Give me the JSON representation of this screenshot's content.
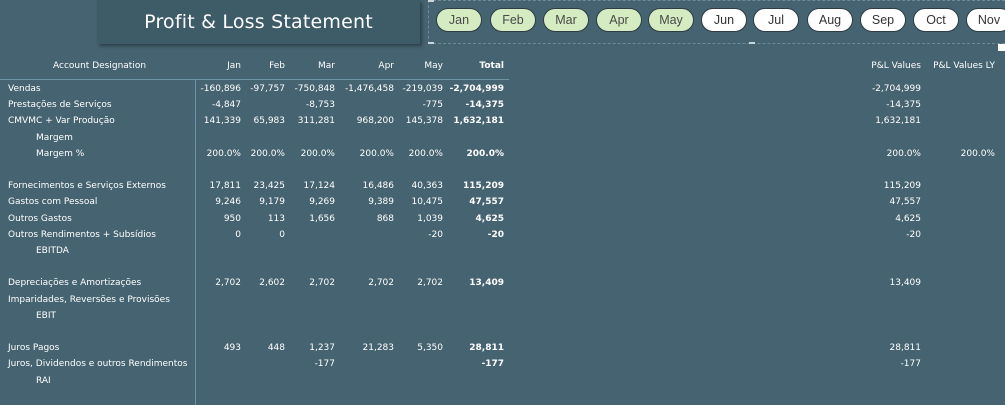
{
  "title": "Profit & Loss Statement",
  "months": [
    {
      "label": "Jan",
      "selected": true
    },
    {
      "label": "Feb",
      "selected": true
    },
    {
      "label": "Mar",
      "selected": true
    },
    {
      "label": "Apr",
      "selected": true
    },
    {
      "label": "May",
      "selected": true
    },
    {
      "label": "Jun",
      "selected": false
    },
    {
      "label": "Jul",
      "selected": false
    },
    {
      "label": "Aug",
      "selected": false
    },
    {
      "label": "Sep",
      "selected": false
    },
    {
      "label": "Oct",
      "selected": false
    },
    {
      "label": "Nov",
      "selected": false
    }
  ],
  "matrix": {
    "header": {
      "account": "Account Designation",
      "months": [
        "Jan",
        "Feb",
        "Mar",
        "Apr",
        "May"
      ],
      "total": "Total"
    },
    "rows": [
      {
        "label": "Vendas",
        "indent": false,
        "values": [
          "-160,896",
          "-97,757",
          "-750,848",
          "-1,476,458",
          "-219,039"
        ],
        "total": "-2,704,999"
      },
      {
        "label": "Prestações de Serviços",
        "indent": false,
        "values": [
          "-4,847",
          "",
          "-8,753",
          "",
          "-775"
        ],
        "total": "-14,375"
      },
      {
        "label": "CMVMC + Var Produção",
        "indent": false,
        "values": [
          "141,339",
          "65,983",
          "311,281",
          "968,200",
          "145,378"
        ],
        "total": "1,632,181"
      },
      {
        "label": "Margem",
        "indent": true,
        "values": [
          "",
          "",
          "",
          "",
          ""
        ],
        "total": ""
      },
      {
        "label": "Margem %",
        "indent": true,
        "values": [
          "200.0%",
          "200.0%",
          "200.0%",
          "200.0%",
          "200.0%"
        ],
        "total": "200.0%"
      },
      {
        "label": "",
        "indent": false,
        "values": [
          "",
          "",
          "",
          "",
          ""
        ],
        "total": ""
      },
      {
        "label": "Fornecimentos e Serviços Externos",
        "indent": false,
        "values": [
          "17,811",
          "23,425",
          "17,124",
          "16,486",
          "40,363"
        ],
        "total": "115,209"
      },
      {
        "label": "Gastos com Pessoal",
        "indent": false,
        "values": [
          "9,246",
          "9,179",
          "9,269",
          "9,389",
          "10,475"
        ],
        "total": "47,557"
      },
      {
        "label": "Outros Gastos",
        "indent": false,
        "values": [
          "950",
          "113",
          "1,656",
          "868",
          "1,039"
        ],
        "total": "4,625"
      },
      {
        "label": "Outros Rendimentos + Subsídios",
        "indent": false,
        "values": [
          "0",
          "0",
          "",
          "",
          "-20"
        ],
        "total": "-20"
      },
      {
        "label": "EBITDA",
        "indent": true,
        "values": [
          "",
          "",
          "",
          "",
          ""
        ],
        "total": ""
      },
      {
        "label": "",
        "indent": false,
        "values": [
          "",
          "",
          "",
          "",
          ""
        ],
        "total": ""
      },
      {
        "label": "Depreciações e Amortizações",
        "indent": false,
        "values": [
          "2,702",
          "2,602",
          "2,702",
          "2,702",
          "2,702"
        ],
        "total": "13,409"
      },
      {
        "label": "Imparidades, Reversões e Provisões",
        "indent": false,
        "values": [
          "",
          "",
          "",
          "",
          ""
        ],
        "total": ""
      },
      {
        "label": "EBIT",
        "indent": true,
        "values": [
          "",
          "",
          "",
          "",
          ""
        ],
        "total": ""
      },
      {
        "label": "",
        "indent": false,
        "values": [
          "",
          "",
          "",
          "",
          ""
        ],
        "total": ""
      },
      {
        "label": "Juros Pagos",
        "indent": false,
        "values": [
          "493",
          "448",
          "1,237",
          "21,283",
          "5,350"
        ],
        "total": "28,811"
      },
      {
        "label": "Juros, Dividendos e outros Rendimentos",
        "indent": false,
        "values": [
          "",
          "",
          "-177",
          "",
          ""
        ],
        "total": "-177"
      },
      {
        "label": "RAI",
        "indent": true,
        "values": [
          "",
          "",
          "",
          "",
          ""
        ],
        "total": ""
      }
    ]
  },
  "pl_table": {
    "header": [
      "P&L Values",
      "P&L Values LY"
    ],
    "rows": [
      [
        "-2,704,999",
        ""
      ],
      [
        "-14,375",
        ""
      ],
      [
        "1,632,181",
        ""
      ],
      [
        "",
        ""
      ],
      [
        "200.0%",
        "200.0%"
      ],
      [
        "",
        ""
      ],
      [
        "115,209",
        ""
      ],
      [
        "47,557",
        ""
      ],
      [
        "4,625",
        ""
      ],
      [
        "-20",
        ""
      ],
      [
        "",
        ""
      ],
      [
        "",
        ""
      ],
      [
        "13,409",
        ""
      ],
      [
        "",
        ""
      ],
      [
        "",
        ""
      ],
      [
        "",
        ""
      ],
      [
        "28,811",
        ""
      ],
      [
        "-177",
        ""
      ],
      [
        "",
        ""
      ]
    ]
  }
}
